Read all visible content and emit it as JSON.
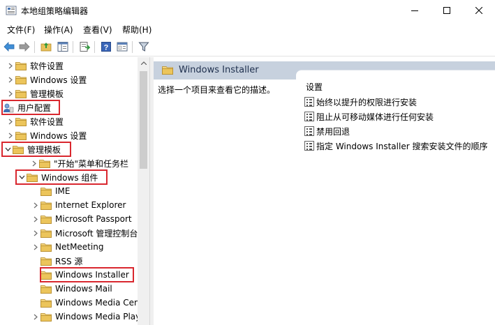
{
  "window": {
    "title": "本地组策略编辑器",
    "controls": [
      "minimize",
      "maximize",
      "close"
    ]
  },
  "menu": {
    "items": [
      "文件(F)",
      "操作(A)",
      "查看(V)",
      "帮助(H)"
    ]
  },
  "toolbar": {
    "icons": [
      "back-icon",
      "forward-icon",
      "up-folder-icon",
      "show-hide-tree-icon",
      "export-list-icon",
      "help-icon",
      "properties-icon",
      "filter-icon"
    ]
  },
  "tree": {
    "nodes": [
      {
        "label": "软件设置",
        "expander": "collapsed"
      },
      {
        "label": "Windows 设置",
        "expander": "collapsed"
      },
      {
        "label": "管理模板",
        "expander": "collapsed"
      },
      {
        "label": "用户配置",
        "expander": "none",
        "icon": "user-config-icon"
      },
      {
        "label": "软件设置",
        "expander": "collapsed"
      },
      {
        "label": "Windows 设置",
        "expander": "collapsed"
      },
      {
        "label": "管理模板",
        "expander": "expanded"
      },
      {
        "label": "\"开始\"菜单和任务栏",
        "expander": "collapsed"
      },
      {
        "label": "Windows 组件",
        "expander": "expanded"
      },
      {
        "label": "IME",
        "expander": "none"
      },
      {
        "label": "Internet Explorer",
        "expander": "collapsed"
      },
      {
        "label": "Microsoft Passport",
        "expander": "collapsed"
      },
      {
        "label": "Microsoft 管理控制台",
        "expander": "collapsed"
      },
      {
        "label": "NetMeeting",
        "expander": "collapsed"
      },
      {
        "label": "RSS 源",
        "expander": "none"
      },
      {
        "label": "Windows Installer",
        "expander": "none",
        "selected": true
      },
      {
        "label": "Windows Mail",
        "expander": "none"
      },
      {
        "label": "Windows Media Center",
        "expander": "none"
      },
      {
        "label": "Windows Media Player",
        "expander": "collapsed"
      }
    ]
  },
  "right": {
    "header": "Windows Installer",
    "description": "选择一个项目来查看它的描述。",
    "settings_heading": "设置",
    "settings": [
      "始终以提升的权限进行安装",
      "阻止从可移动媒体进行任何安装",
      "禁用回退",
      "指定 Windows Installer 搜索安装文件的顺序"
    ]
  },
  "colors": {
    "highlight_border": "#d9272e",
    "header_bg": "#c7d1de",
    "folder_yellow": "#e8c15a"
  }
}
